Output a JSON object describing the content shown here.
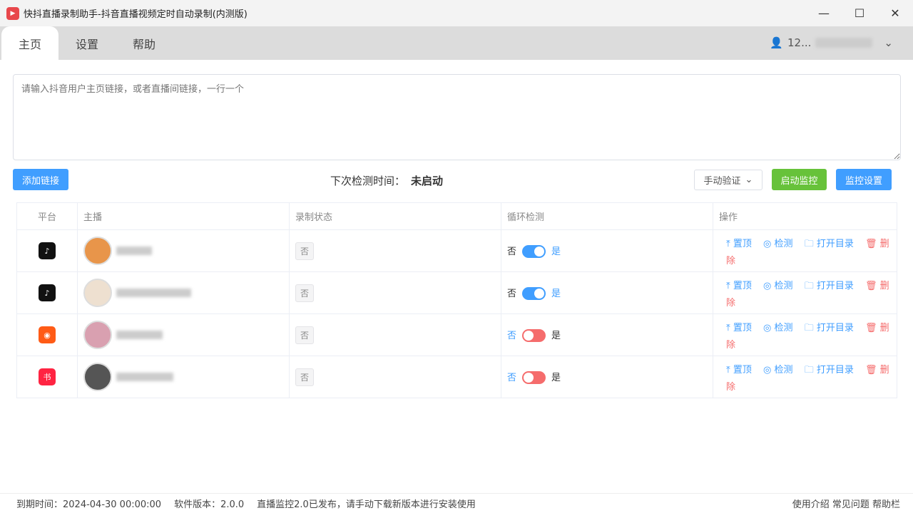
{
  "window": {
    "title": "快抖直播录制助手-抖音直播视频定时自动录制(内测版)"
  },
  "tabs": [
    {
      "label": "主页"
    },
    {
      "label": "设置"
    },
    {
      "label": "帮助"
    }
  ],
  "user": {
    "name": "12..."
  },
  "input": {
    "placeholder": "请输入抖音用户主页链接，或者直播间链接，一行一个",
    "value": ""
  },
  "toolbar": {
    "add_link": "添加链接",
    "next_check_label": "下次检测时间：",
    "next_check_value": "未启动",
    "manual_verify": "手动验证",
    "start_monitor": "启动监控",
    "monitor_settings": "监控设置"
  },
  "table": {
    "headers": [
      "平台",
      "主播",
      "录制状态",
      "循环检测",
      "操作"
    ],
    "rows": [
      {
        "platform": "douyin",
        "status": "否",
        "loop": true
      },
      {
        "platform": "douyin",
        "status": "否",
        "loop": true
      },
      {
        "platform": "kuaishou",
        "status": "否",
        "loop": false
      },
      {
        "platform": "xiaohongshu",
        "status": "否",
        "loop": false
      }
    ],
    "switch_no": "否",
    "switch_yes": "是",
    "actions": {
      "top": "置顶",
      "check": "检测",
      "open_dir": "打开目录",
      "delete": "删除"
    }
  },
  "footer": {
    "expire": "到期时间：2024-04-30 00:00:00",
    "version": "软件版本：2.0.0",
    "notice": "直播监控2.0已发布，请手动下载新版本进行安装使用",
    "links": "使用介绍 常见问题 帮助栏"
  },
  "colors": {
    "primary": "#409eff",
    "success": "#67c23a",
    "danger": "#f56c6c"
  }
}
